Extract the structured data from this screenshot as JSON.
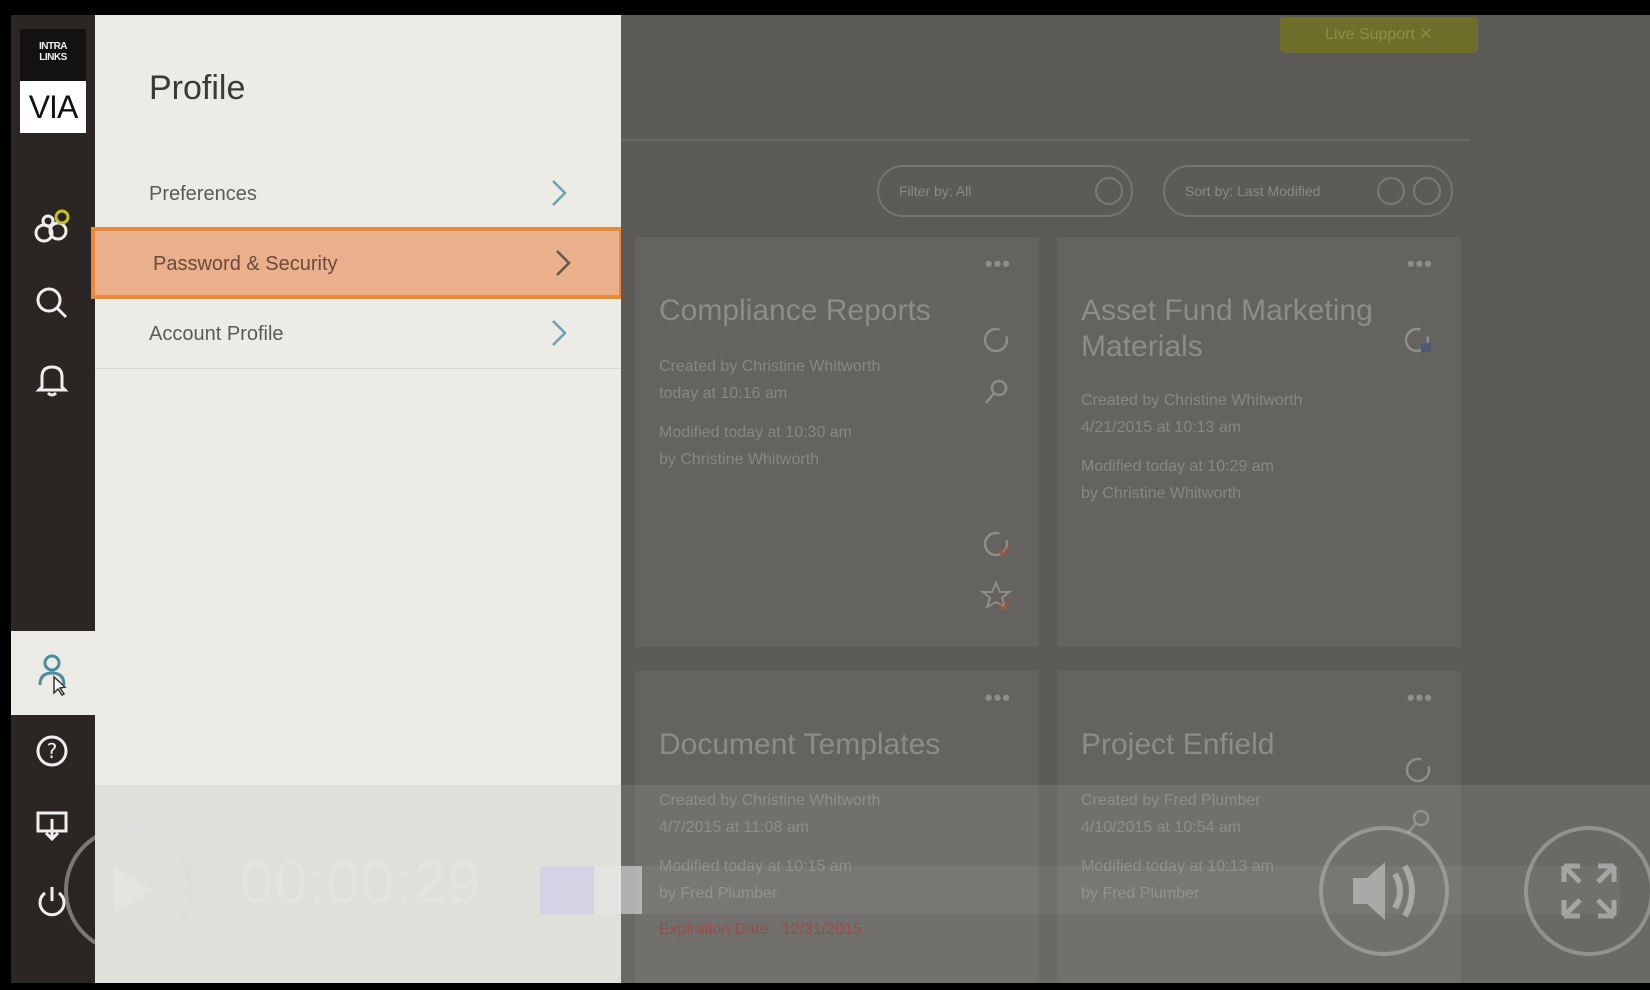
{
  "logo": {
    "top_text": "INTRA\nLINKS",
    "bottom_text": "VIA"
  },
  "rail": {
    "items": [
      {
        "name": "exchanges",
        "icon": "exchanges-icon"
      },
      {
        "name": "search",
        "icon": "search-icon"
      },
      {
        "name": "notifications",
        "icon": "bell-icon"
      },
      {
        "name": "profile",
        "icon": "user-icon",
        "active": true
      },
      {
        "name": "help",
        "icon": "help-icon"
      },
      {
        "name": "download",
        "icon": "download-icon"
      },
      {
        "name": "logout",
        "icon": "power-icon"
      }
    ]
  },
  "profile": {
    "title": "Profile",
    "menu": [
      {
        "label": "Preferences"
      },
      {
        "label": "Password & Security",
        "highlighted": true
      },
      {
        "label": "Account Profile"
      }
    ]
  },
  "main": {
    "support_label": "Live Support",
    "filter_label": "Filter by: All",
    "sort_label": "Sort by: Last Modified",
    "cards": [
      {
        "title": "Compliance Reports",
        "created": "Created by Christine Whitworth",
        "created_date": "today at 10:16 am",
        "modified": "Modified today at 10:30 am",
        "modified_by": "by Christine Whitworth",
        "expiration": ""
      },
      {
        "title": "Asset Fund Marketing Materials",
        "created": "Created by Christine Whitworth",
        "created_date": "4/21/2015 at 10:13 am",
        "modified": "Modified today at 10:29 am",
        "modified_by": "by Christine Whitworth",
        "expiration": ""
      },
      {
        "title": "Document Templates",
        "created": "Created by Christine Whitworth",
        "created_date": "4/7/2015 at 11:08 am",
        "modified": "Modified today at 10:15 am",
        "modified_by": "by Fred Plumber",
        "expiration": "Expiration Date : 12/31/2015"
      },
      {
        "title": "Project Enfield",
        "created": "Created by Fred Plumber",
        "created_date": "4/10/2015 at 10:54 am",
        "modified": "Modified today at 10:13 am",
        "modified_by": "by Fred Plumber",
        "expiration": ""
      }
    ]
  },
  "player": {
    "timestamp": "00:00:29",
    "progress": 0.05
  }
}
